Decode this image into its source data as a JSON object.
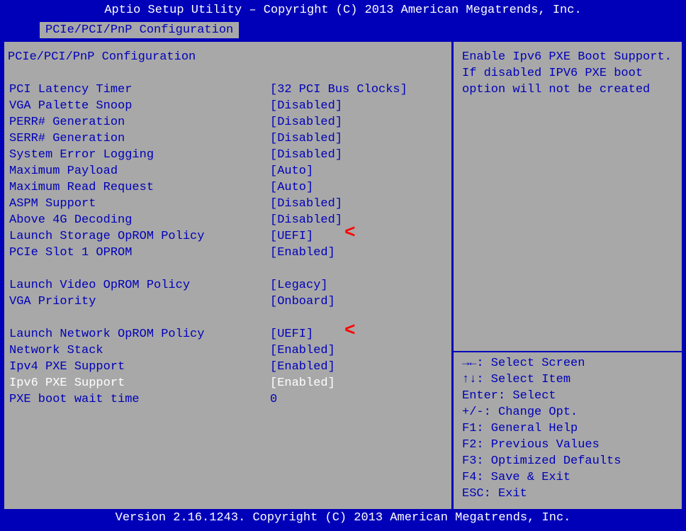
{
  "title": "Aptio Setup Utility – Copyright (C) 2013 American Megatrends, Inc.",
  "tab": "PCIe/PCI/PnP Configuration",
  "panel_heading": "PCIe/PCI/PnP Configuration",
  "rows": [
    {
      "label": "PCI Latency Timer",
      "value": "[32 PCI Bus Clocks]"
    },
    {
      "label": "VGA Palette Snoop",
      "value": "[Disabled]"
    },
    {
      "label": "PERR# Generation",
      "value": "[Disabled]"
    },
    {
      "label": "SERR# Generation",
      "value": "[Disabled]"
    },
    {
      "label": "System Error Logging",
      "value": "[Disabled]"
    },
    {
      "label": "Maximum Payload",
      "value": "[Auto]"
    },
    {
      "label": "Maximum Read Request",
      "value": "[Auto]"
    },
    {
      "label": "ASPM Support",
      "value": "[Disabled]"
    },
    {
      "label": "Above 4G Decoding",
      "value": "[Disabled]"
    },
    {
      "label": "Launch Storage OpROM Policy",
      "value": "[UEFI]",
      "arrow": true
    },
    {
      "label": "PCIe Slot 1 OPROM",
      "value": "[Enabled]"
    },
    {
      "blank": true
    },
    {
      "label": "Launch Video OpROM Policy",
      "value": "[Legacy]"
    },
    {
      "label": "VGA Priority",
      "value": "[Onboard]"
    },
    {
      "blank": true
    },
    {
      "label": "Launch Network OpROM Policy",
      "value": "[UEFI]",
      "arrow": true
    },
    {
      "label": "Network Stack",
      "value": "[Enabled]"
    },
    {
      "label": "Ipv4 PXE Support",
      "value": "[Enabled]"
    },
    {
      "label": "Ipv6 PXE Support",
      "value": "[Enabled]",
      "selected": true
    },
    {
      "label": "PXE boot wait time",
      "value": "0"
    }
  ],
  "help_text": "Enable Ipv6 PXE Boot Support. If disabled IPV6 PXE boot option will not be created",
  "help_keys": [
    "→←: Select Screen",
    "↑↓: Select Item",
    "Enter: Select",
    "+/-: Change Opt.",
    "F1: General Help",
    "F2: Previous Values",
    "F3: Optimized Defaults",
    "F4: Save & Exit",
    "ESC: Exit"
  ],
  "footer": "Version 2.16.1243. Copyright (C) 2013 American Megatrends, Inc."
}
